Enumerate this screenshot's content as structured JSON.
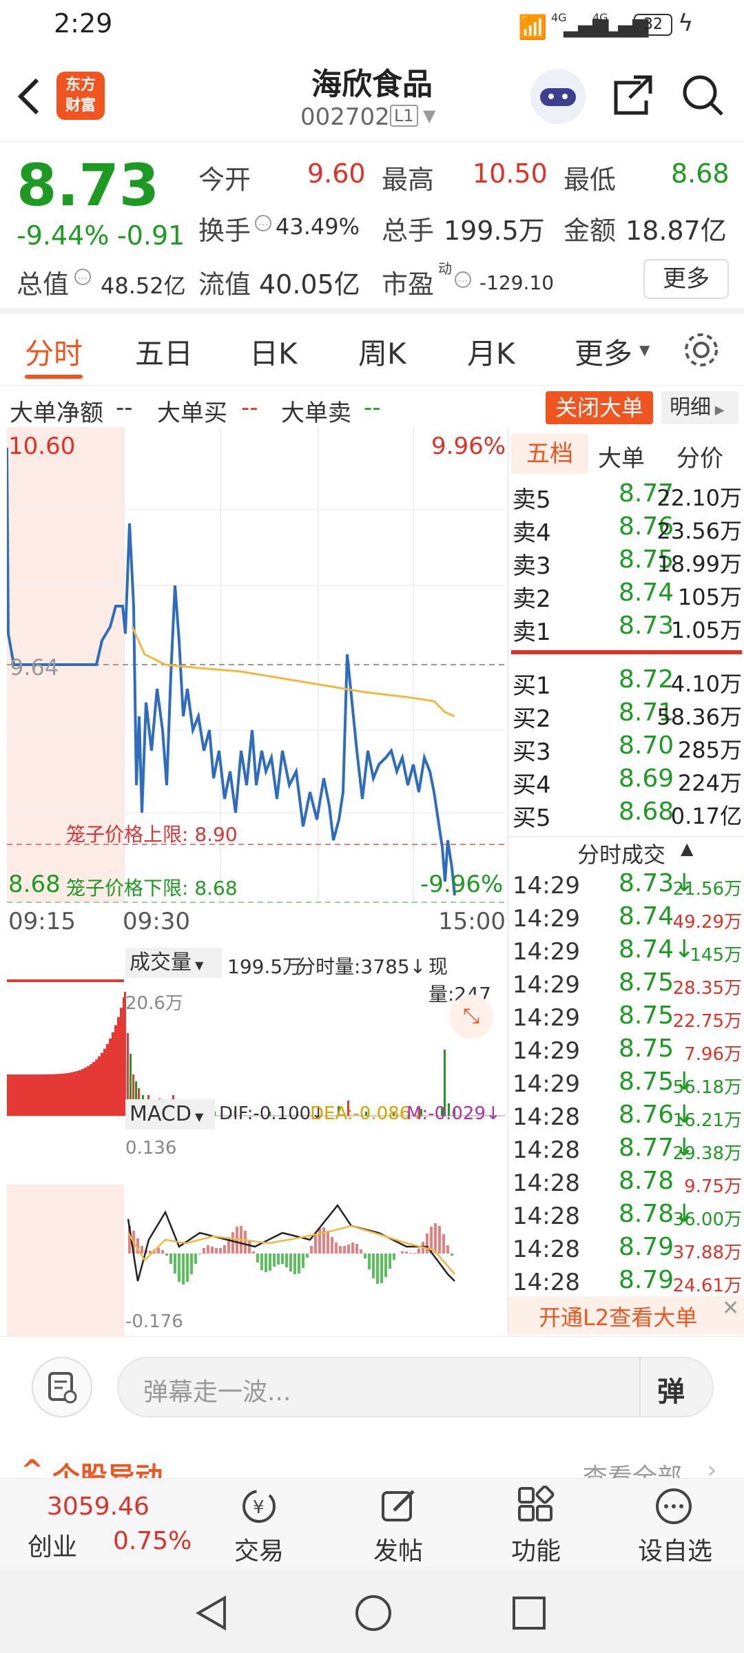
{
  "status": {
    "time": "2:29",
    "net1": "4G",
    "net2": "4G",
    "battery": "32"
  },
  "nav": {
    "title": "海欣食品",
    "code": "002702",
    "level": "L1",
    "brand_line1": "东方",
    "brand_line2": "财富"
  },
  "quote": {
    "price": "8.73",
    "change_pct": "-9.44%",
    "change": "-0.91",
    "open_label": "今开",
    "open": "9.60",
    "high_label": "最高",
    "high": "10.50",
    "low_label": "最低",
    "low": "8.68",
    "turnover_label": "换手",
    "turnover": "43.49%",
    "volume_label": "总手",
    "volume": "199.5万",
    "amount_label": "金额",
    "amount": "18.87亿",
    "mktcap_label": "总值",
    "mktcap": "48.52亿",
    "float_label": "流值",
    "float": "40.05亿",
    "pe_label": "市盈",
    "pe_sup": "动",
    "pe": "-129.10",
    "more": "更多"
  },
  "tabs": [
    "分时",
    "五日",
    "日K",
    "周K",
    "月K",
    "更多"
  ],
  "bigorder": {
    "net_label": "大单净额",
    "net": "--",
    "buy_label": "大单买",
    "buy": "--",
    "sell_label": "大单卖",
    "sell": "--",
    "close_btn": "关闭大单",
    "detail": "明细"
  },
  "chart": {
    "price_top": "10.60",
    "pct_top": "9.96%",
    "price_bottom": "8.68",
    "pct_bottom": "-9.96%",
    "prev_close": "9.64",
    "upper_limit": "笼子价格上限: 8.90",
    "lower_limit": "笼子价格下限: 8.68",
    "t_start": "09:15",
    "t_mid": "09:30",
    "t_end": "15:00",
    "volume_label": "成交量",
    "volume_total": "199.5万",
    "minute_vol": "分时量:3785↓",
    "current_vol": "现量:247",
    "vol_max": "20.6万",
    "macd_label": "MACD",
    "dif": "DIF:-0.100↓",
    "dea": "DEA:-0.086↓",
    "m": "M:-0.029↓",
    "macd_max": "0.136",
    "macd_min": "-0.176"
  },
  "orderbook": {
    "tabs": [
      "五档",
      "大单",
      "分价"
    ],
    "sells": [
      {
        "label": "卖5",
        "price": "8.77",
        "vol": "22.10万"
      },
      {
        "label": "卖4",
        "price": "8.76",
        "vol": "23.56万"
      },
      {
        "label": "卖3",
        "price": "8.75",
        "vol": "18.99万"
      },
      {
        "label": "卖2",
        "price": "8.74",
        "vol": "105万"
      },
      {
        "label": "卖1",
        "price": "8.73",
        "vol": "1.05万"
      }
    ],
    "buys": [
      {
        "label": "买1",
        "price": "8.72",
        "vol": "4.10万"
      },
      {
        "label": "买2",
        "price": "8.71",
        "vol": "58.36万"
      },
      {
        "label": "买3",
        "price": "8.70",
        "vol": "285万"
      },
      {
        "label": "买4",
        "price": "8.69",
        "vol": "224万"
      },
      {
        "label": "买5",
        "price": "8.68",
        "vol": "0.17亿"
      }
    ],
    "trades_header": "分时成交",
    "trades": [
      {
        "t": "14:29",
        "p": "8.73↓",
        "v": "21.56万",
        "c": "green"
      },
      {
        "t": "14:29",
        "p": "8.74",
        "v": "49.29万",
        "c": "red"
      },
      {
        "t": "14:29",
        "p": "8.74↓",
        "v": "145万",
        "c": "green"
      },
      {
        "t": "14:29",
        "p": "8.75",
        "v": "28.35万",
        "c": "red"
      },
      {
        "t": "14:29",
        "p": "8.75",
        "v": "22.75万",
        "c": "red"
      },
      {
        "t": "14:29",
        "p": "8.75",
        "v": "7.96万",
        "c": "red"
      },
      {
        "t": "14:29",
        "p": "8.75↓",
        "v": "56.18万",
        "c": "green"
      },
      {
        "t": "14:28",
        "p": "8.76↓",
        "v": "16.21万",
        "c": "green"
      },
      {
        "t": "14:28",
        "p": "8.77↓",
        "v": "29.38万",
        "c": "green"
      },
      {
        "t": "14:28",
        "p": "8.78",
        "v": "9.75万",
        "c": "red"
      },
      {
        "t": "14:28",
        "p": "8.78↓",
        "v": "36.00万",
        "c": "green"
      },
      {
        "t": "14:28",
        "p": "8.79",
        "v": "37.88万",
        "c": "red"
      },
      {
        "t": "14:28",
        "p": "8.79",
        "v": "24.61万",
        "c": "red"
      }
    ],
    "l2": "开通L2查看大单"
  },
  "comment": {
    "placeholder": "弹幕走一波...",
    "danmu": "弹"
  },
  "section": {
    "title": "个股异动",
    "more": "查看全部"
  },
  "bottomnav": {
    "index_value": "3059.46",
    "index_name": "创业",
    "index_pct": "0.75%",
    "trade": "交易",
    "post": "发帖",
    "func": "功能",
    "addfav": "设自选"
  },
  "colors": {
    "up": "#e03127",
    "down": "#1d9a21",
    "accent": "#f0551f",
    "line": "#2e6cc0",
    "avg": "#f0b840"
  }
}
